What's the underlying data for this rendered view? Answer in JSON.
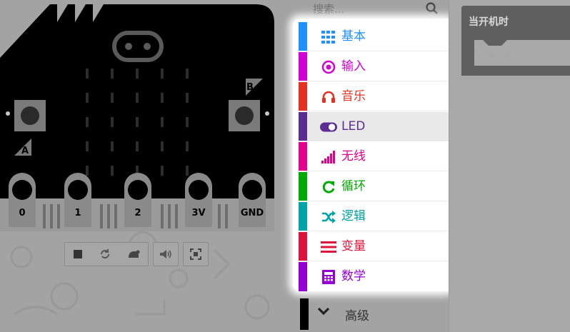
{
  "simulator": {
    "board": {
      "button_a": "A",
      "button_b": "B",
      "pins": [
        "0",
        "1",
        "2",
        "3V",
        "GND"
      ]
    },
    "toolbar": {
      "buttons": [
        {
          "name": "stop-icon"
        },
        {
          "name": "restart-icon"
        },
        {
          "name": "slow-motion-icon"
        },
        {
          "name": "mute-icon"
        },
        {
          "name": "fullscreen-icon"
        }
      ]
    }
  },
  "toolbox": {
    "search": {
      "placeholder": "搜索..."
    },
    "categories": [
      {
        "label": "基本",
        "color": "#1e90ff",
        "icon": "grid-icon"
      },
      {
        "label": "输入",
        "color": "#d400d4",
        "icon": "target-icon"
      },
      {
        "label": "音乐",
        "color": "#e63022",
        "icon": "headphones-icon"
      },
      {
        "label": "LED",
        "color": "#5c2d91",
        "icon": "toggle-icon"
      },
      {
        "label": "无线",
        "color": "#e3008c",
        "icon": "signal-icon"
      },
      {
        "label": "循环",
        "color": "#00aa00",
        "icon": "refresh-icon"
      },
      {
        "label": "逻辑",
        "color": "#00a4a6",
        "icon": "shuffle-icon"
      },
      {
        "label": "变量",
        "color": "#dc143c",
        "icon": "list-icon"
      },
      {
        "label": "数学",
        "color": "#9400d3",
        "icon": "calculator-icon"
      }
    ],
    "advanced": {
      "label": "高级",
      "color": "#000000"
    }
  },
  "workspace": {
    "on_start_block": {
      "label": "当开机时",
      "color": "#5f5f5f"
    }
  }
}
